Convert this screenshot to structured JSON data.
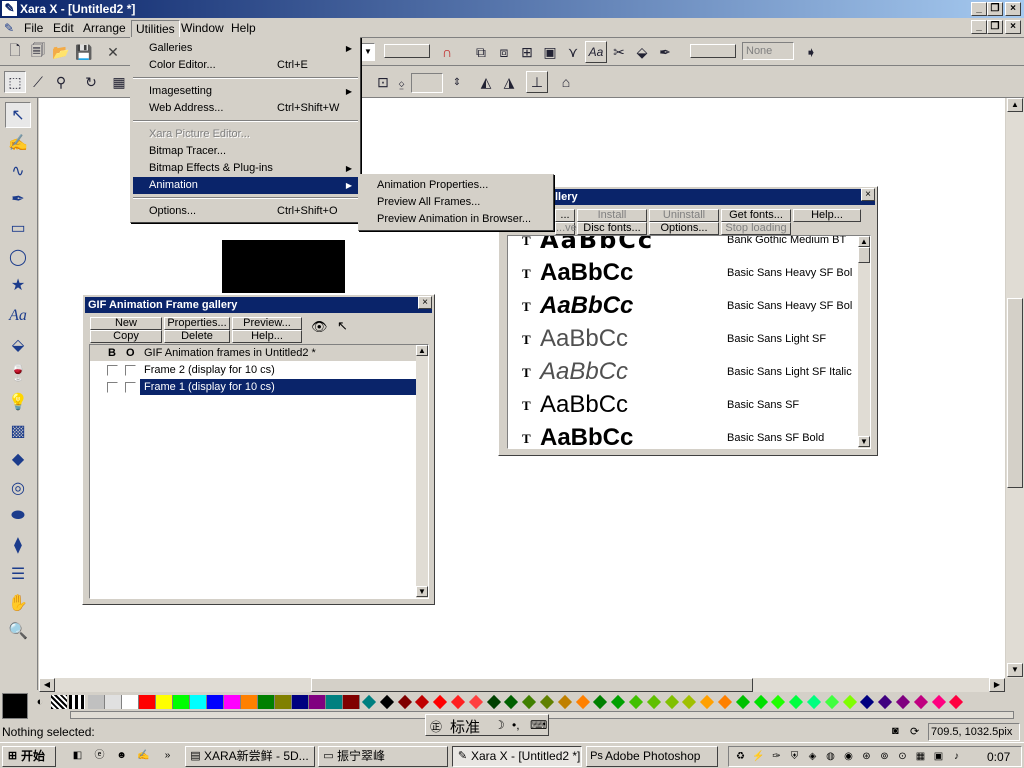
{
  "window": {
    "title": "Xara X - [Untitled2 *]"
  },
  "menubar": {
    "items": [
      "File",
      "Edit",
      "Arrange",
      "Utilities",
      "Window",
      "Help"
    ]
  },
  "utilities_menu": {
    "items": [
      {
        "label": "Galleries",
        "shortcut": "",
        "submenu": true,
        "disabled": false
      },
      {
        "label": "Color Editor...",
        "shortcut": "Ctrl+E",
        "submenu": false,
        "disabled": false
      },
      {
        "label": "Imagesetting",
        "shortcut": "",
        "submenu": true,
        "disabled": false
      },
      {
        "label": "Web Address...",
        "shortcut": "Ctrl+Shift+W",
        "submenu": false,
        "disabled": false
      },
      {
        "label": "Xara Picture Editor...",
        "shortcut": "",
        "submenu": false,
        "disabled": true
      },
      {
        "label": "Bitmap Tracer...",
        "shortcut": "",
        "submenu": false,
        "disabled": false
      },
      {
        "label": "Bitmap Effects & Plug-ins",
        "shortcut": "",
        "submenu": true,
        "disabled": false
      },
      {
        "label": "Animation",
        "shortcut": "",
        "submenu": true,
        "disabled": false
      },
      {
        "label": "Options...",
        "shortcut": "Ctrl+Shift+O",
        "submenu": false,
        "disabled": false
      }
    ]
  },
  "animation_submenu": {
    "items": [
      "Animation Properties...",
      "Preview All Frames...",
      "Preview Animation in Browser..."
    ]
  },
  "toolbar": {
    "none_field": "None"
  },
  "font_gallery": {
    "title_fragment": "llery",
    "buttons": [
      "...",
      "Install",
      "Uninstall",
      "Get fonts...",
      "Help...",
      "...ve",
      "Disc fonts...",
      "Options...",
      "Stop loading"
    ],
    "fonts": [
      {
        "preview": "AaBbCc",
        "name": "Bank Gothic Medium BT"
      },
      {
        "preview": "AaBbCc",
        "name": "Basic Sans Heavy SF Bol"
      },
      {
        "preview": "AaBbCc",
        "name": "Basic Sans Heavy SF Bol"
      },
      {
        "preview": "AaBbCc",
        "name": "Basic Sans Light SF"
      },
      {
        "preview": "AaBbCc",
        "name": "Basic Sans Light SF Italic"
      },
      {
        "preview": "AaBbCc",
        "name": "Basic Sans SF"
      },
      {
        "preview": "AaBbCc",
        "name": "Basic Sans SF Bold"
      }
    ]
  },
  "gif_gallery": {
    "title": "GIF Animation Frame gallery",
    "buttons": {
      "new": "New",
      "copy": "Copy",
      "properties": "Properties...",
      "delete": "Delete",
      "preview": "Preview...",
      "help": "Help..."
    },
    "header": {
      "b": "B",
      "o": "O",
      "label": "GIF Animation frames in Untitled2 *"
    },
    "frames": [
      "Frame 2 (display for 10 cs)",
      "Frame 1 (display for 10 cs)"
    ]
  },
  "ime": {
    "label": "标准"
  },
  "status": {
    "left": "Nothing selected:",
    "coords": "709.5, 1032.5pix"
  },
  "taskbar": {
    "start": "开始",
    "tasks": [
      "XARA新尝鲜 - 5D...",
      "振宁翠峰",
      "Xara X - [Untitled2 *]",
      "Adobe Photoshop"
    ],
    "clock": "0:07"
  },
  "colors": {
    "title_blue": "#0a246a",
    "highlight": "#0a246a",
    "face": "#d4d0c8"
  },
  "palette": [
    "#c0c0c0",
    "#e0e0e0",
    "#ffffff",
    "#ff0000",
    "#ffff00",
    "#00ff00",
    "#00ffff",
    "#0000ff",
    "#ff00ff",
    "#ff8000",
    "#008000",
    "#808000",
    "#000080",
    "#800080",
    "#008080",
    "#800000"
  ],
  "diamonds": [
    "#008080",
    "#000000",
    "#800000",
    "#c00000",
    "#ff0000",
    "#ff2020",
    "#ff4040",
    "#004000",
    "#006000",
    "#408000",
    "#608000",
    "#c08000",
    "#ff8000",
    "#008000",
    "#00a000",
    "#40c000",
    "#60c000",
    "#80c000",
    "#a0c000",
    "#ffa000",
    "#ff8000",
    "#00c000",
    "#00e000",
    "#20ff00",
    "#00ff40",
    "#00ff80",
    "#40ff40",
    "#80ff00",
    "#000080",
    "#400080",
    "#800080",
    "#c00080",
    "#ff0080",
    "#ff0040"
  ]
}
